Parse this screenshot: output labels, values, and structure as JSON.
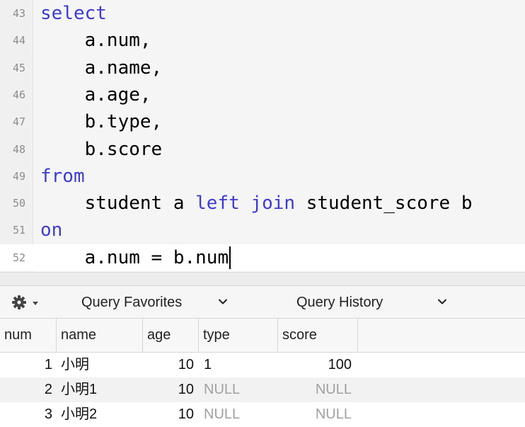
{
  "editor": {
    "lines": [
      {
        "num": "43",
        "tokens": [
          {
            "t": "select",
            "kw": true
          }
        ]
      },
      {
        "num": "44",
        "tokens": [
          {
            "t": "    a.num,",
            "kw": false
          }
        ]
      },
      {
        "num": "45",
        "tokens": [
          {
            "t": "    a.name,",
            "kw": false
          }
        ]
      },
      {
        "num": "46",
        "tokens": [
          {
            "t": "    a.age,",
            "kw": false
          }
        ]
      },
      {
        "num": "47",
        "tokens": [
          {
            "t": "    b.type,",
            "kw": false
          }
        ]
      },
      {
        "num": "48",
        "tokens": [
          {
            "t": "    b.score",
            "kw": false
          }
        ]
      },
      {
        "num": "49",
        "tokens": [
          {
            "t": "from",
            "kw": true
          }
        ]
      },
      {
        "num": "50",
        "tokens": [
          {
            "t": "    student a ",
            "kw": false
          },
          {
            "t": "left join",
            "kw": true
          },
          {
            "t": " student_score b",
            "kw": false
          }
        ]
      },
      {
        "num": "51",
        "tokens": [
          {
            "t": "on",
            "kw": true
          }
        ]
      },
      {
        "num": "52",
        "tokens": [
          {
            "t": "    a.num = b.num",
            "kw": false
          }
        ]
      }
    ]
  },
  "toolbar": {
    "query_favorites": "Query Favorites",
    "query_history": "Query History"
  },
  "results": {
    "columns": [
      "num",
      "name",
      "age",
      "type",
      "score"
    ],
    "rows": [
      [
        "1",
        "小明",
        "10",
        "1",
        "100"
      ],
      [
        "2",
        "小明1",
        "10",
        "NULL",
        "NULL"
      ],
      [
        "3",
        "小明2",
        "10",
        "NULL",
        "NULL"
      ]
    ]
  },
  "colors": {
    "keyword": "#3b3bd6",
    "null_text": "#a0a0a0"
  }
}
